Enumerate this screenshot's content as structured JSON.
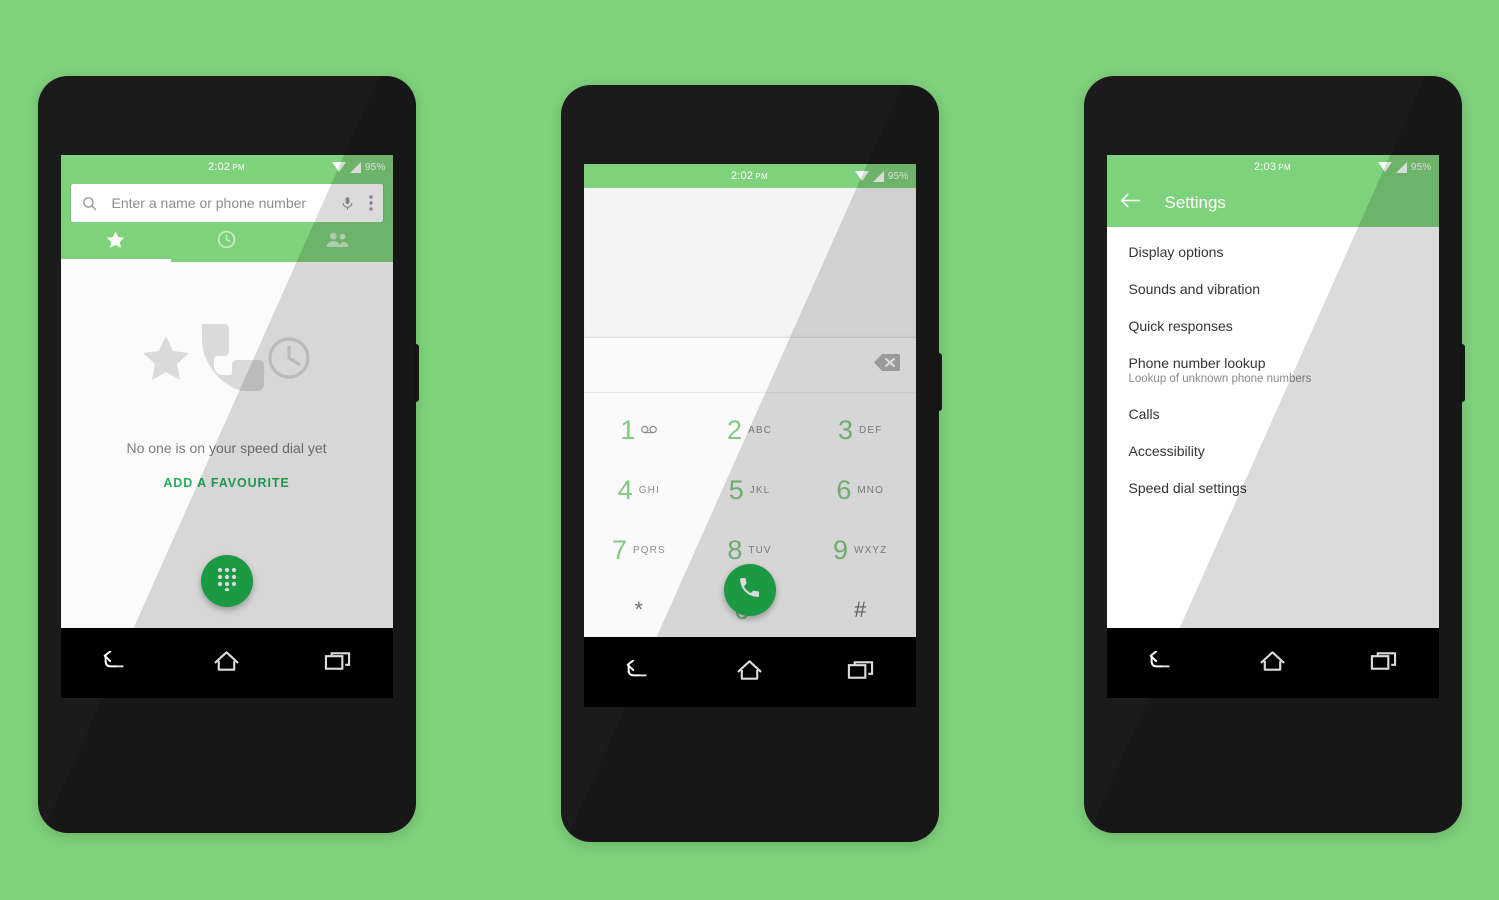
{
  "theme": {
    "background": "#7fd27c",
    "accent_green": "#7fd27c",
    "fab_green": "#21b44f",
    "link_green": "#26b05c",
    "key_digit_green": "#82c982",
    "phone_body": "#1b1b1b"
  },
  "phones": [
    {
      "name": "speed-dial",
      "statusbar": {
        "time": "2:02",
        "meridiem": "PM",
        "battery": "95%",
        "icons": [
          "wifi-icon",
          "signal-icon"
        ]
      },
      "search": {
        "placeholder": "Enter a name or phone number",
        "search_icon": "search-icon",
        "voice_icon": "microphone-icon",
        "overflow_icon": "overflow-menu-icon"
      },
      "tabs": [
        {
          "name": "favourites",
          "icon": "star-icon",
          "selected": true
        },
        {
          "name": "recents",
          "icon": "clock-icon",
          "selected": false
        },
        {
          "name": "contacts",
          "icon": "people-icon",
          "selected": false
        }
      ],
      "empty_state": {
        "art_icons": [
          "star-icon",
          "phone-handset-icon",
          "clock-icon"
        ],
        "message": "No one is on your speed dial yet",
        "cta": "ADD A FAVOURITE"
      },
      "fab": {
        "icon": "dialpad-icon",
        "label": "Open dialpad"
      }
    },
    {
      "name": "dialpad",
      "statusbar": {
        "time": "2:02",
        "meridiem": "PM",
        "battery": "95%",
        "icons": [
          "wifi-icon",
          "signal-icon"
        ]
      },
      "number_field": {
        "value": "",
        "delete_icon": "backspace-icon"
      },
      "keys": [
        [
          {
            "digit": "1",
            "letters": "",
            "icon": "voicemail-icon"
          },
          {
            "digit": "2",
            "letters": "ABC",
            "icon": ""
          },
          {
            "digit": "3",
            "letters": "DEF",
            "icon": ""
          }
        ],
        [
          {
            "digit": "4",
            "letters": "GHI",
            "icon": ""
          },
          {
            "digit": "5",
            "letters": "JKL",
            "icon": ""
          },
          {
            "digit": "6",
            "letters": "MNO",
            "icon": ""
          }
        ],
        [
          {
            "digit": "7",
            "letters": "PQRS",
            "icon": ""
          },
          {
            "digit": "8",
            "letters": "TUV",
            "icon": ""
          },
          {
            "digit": "9",
            "letters": "WXYZ",
            "icon": ""
          }
        ],
        [
          {
            "digit": "*",
            "letters": "",
            "icon": ""
          },
          {
            "digit": "0",
            "letters": "+",
            "icon": ""
          },
          {
            "digit": "#",
            "letters": "",
            "icon": ""
          }
        ]
      ],
      "call_button": {
        "icon": "phone-handset-icon",
        "label": "Call"
      }
    },
    {
      "name": "settings",
      "statusbar": {
        "time": "2:03",
        "meridiem": "PM",
        "battery": "95%",
        "icons": [
          "wifi-icon",
          "signal-icon"
        ]
      },
      "appbar": {
        "back_icon": "back-arrow-icon",
        "title": "Settings"
      },
      "items": [
        {
          "title": "Display options",
          "subtitle": ""
        },
        {
          "title": "Sounds and vibration",
          "subtitle": ""
        },
        {
          "title": "Quick responses",
          "subtitle": ""
        },
        {
          "title": "Phone number lookup",
          "subtitle": "Lookup of unknown phone numbers"
        },
        {
          "title": "Calls",
          "subtitle": ""
        },
        {
          "title": "Accessibility",
          "subtitle": ""
        },
        {
          "title": "Speed dial settings",
          "subtitle": ""
        }
      ]
    }
  ],
  "navbar": [
    {
      "name": "back",
      "icon": "back-nav-icon"
    },
    {
      "name": "home",
      "icon": "home-nav-icon"
    },
    {
      "name": "recents",
      "icon": "recents-nav-icon"
    }
  ]
}
